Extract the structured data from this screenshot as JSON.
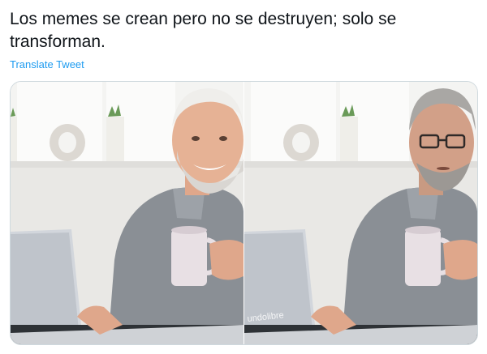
{
  "tweet": {
    "text": "Los memes se crean pero no se destruyen; solo se transforman.",
    "translate_label": "Translate Tweet"
  },
  "media": {
    "left_photo": {
      "subject": "smiling older man with white beard holding a mug at a laptop"
    },
    "right_photo": {
      "subject": "same scene with face swapped for a man wearing glasses",
      "watermark": "undolibre"
    }
  },
  "colors": {
    "text": "#0f1419",
    "link": "#1d9bf0",
    "border": "#cfd9de"
  }
}
